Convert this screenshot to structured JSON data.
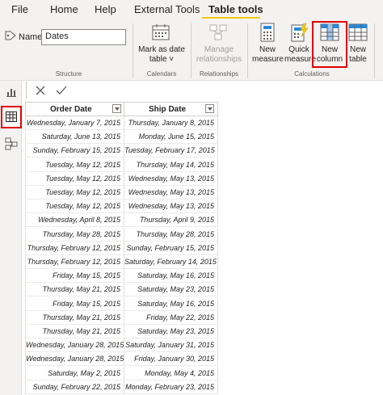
{
  "menu": {
    "tabs": [
      {
        "label": "File"
      },
      {
        "label": "Home"
      },
      {
        "label": "Help"
      },
      {
        "label": "External Tools"
      },
      {
        "label": "Table tools"
      }
    ],
    "active_tab": "Table tools"
  },
  "ribbon": {
    "name_label": "Name",
    "name_value": "Dates",
    "groups": {
      "structure": "Structure",
      "calendars": "Calendars",
      "relationships": "Relationships",
      "calculations": "Calculations"
    },
    "buttons": {
      "mark_as_date_table": [
        "Mark as date",
        "table ˅"
      ],
      "manage_relationships": [
        "Manage",
        "relationships"
      ],
      "new_measure": [
        "New",
        "measure"
      ],
      "quick_measure": [
        "Quick",
        "measure"
      ],
      "new_column": [
        "New",
        "column"
      ],
      "new_table": [
        "New",
        "table"
      ]
    }
  },
  "table": {
    "columns": [
      "Order Date",
      "Ship Date"
    ],
    "rows": [
      [
        "Wednesday, January 7, 2015",
        "Thursday, January 8, 2015"
      ],
      [
        "Saturday, June 13, 2015",
        "Monday, June 15, 2015"
      ],
      [
        "Sunday, February 15, 2015",
        "Tuesday, February 17, 2015"
      ],
      [
        "Tuesday, May 12, 2015",
        "Thursday, May 14, 2015"
      ],
      [
        "Tuesday, May 12, 2015",
        "Wednesday, May 13, 2015"
      ],
      [
        "Tuesday, May 12, 2015",
        "Wednesday, May 13, 2015"
      ],
      [
        "Tuesday, May 12, 2015",
        "Wednesday, May 13, 2015"
      ],
      [
        "Wednesday, April 8, 2015",
        "Thursday, April 9, 2015"
      ],
      [
        "Thursday, May 28, 2015",
        "Thursday, May 28, 2015"
      ],
      [
        "Thursday, February 12, 2015",
        "Sunday, February 15, 2015"
      ],
      [
        "Thursday, February 12, 2015",
        "Saturday, February 14, 2015"
      ],
      [
        "Friday, May 15, 2015",
        "Saturday, May 16, 2015"
      ],
      [
        "Thursday, May 21, 2015",
        "Saturday, May 23, 2015"
      ],
      [
        "Friday, May 15, 2015",
        "Saturday, May 16, 2015"
      ],
      [
        "Thursday, May 21, 2015",
        "Friday, May 22, 2015"
      ],
      [
        "Thursday, May 21, 2015",
        "Saturday, May 23, 2015"
      ],
      [
        "Wednesday, January 28, 2015",
        "Saturday, January 31, 2015"
      ],
      [
        "Wednesday, January 28, 2015",
        "Friday, January 30, 2015"
      ],
      [
        "Saturday, May 2, 2015",
        "Monday, May 4, 2015"
      ],
      [
        "Sunday, February 22, 2015",
        "Monday, February 23, 2015"
      ]
    ]
  },
  "colors": {
    "accent": "#f2c811",
    "highlight": "#e00000",
    "ribbon_bg": "#f3f2f1"
  }
}
